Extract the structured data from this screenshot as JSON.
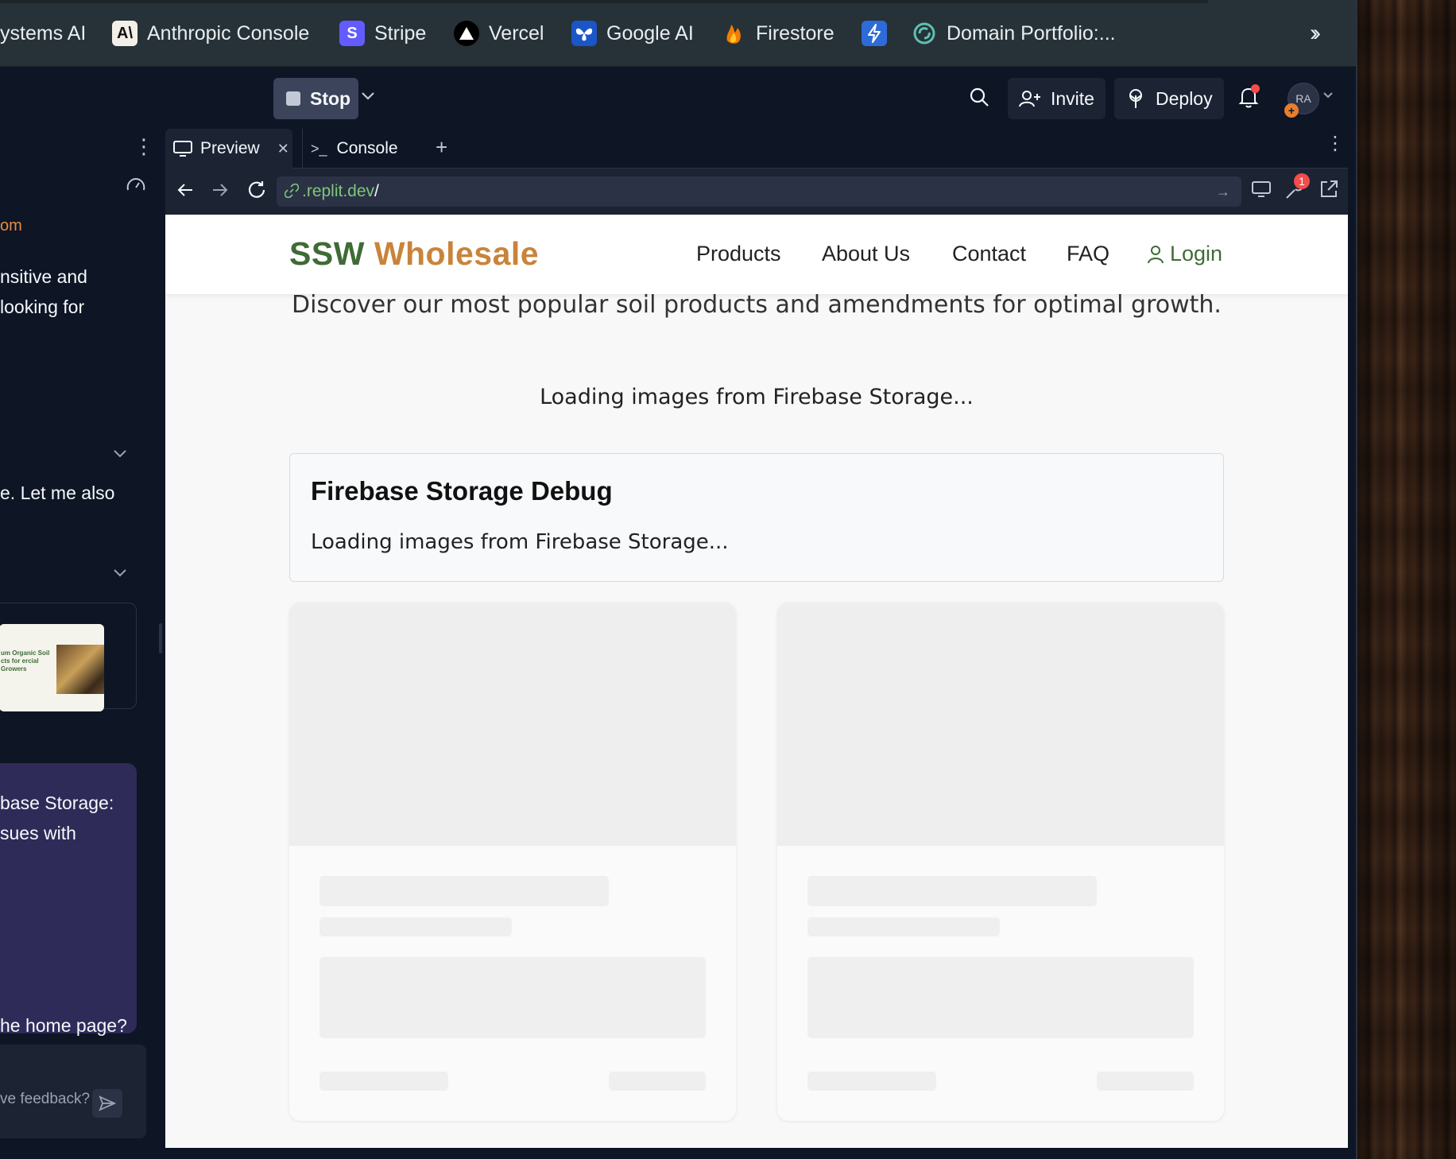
{
  "bookmarks": [
    {
      "label": "ystems AI",
      "icon": "none"
    },
    {
      "label": "Anthropic Console",
      "icon": "anthropic-icon"
    },
    {
      "label": "Stripe",
      "icon": "stripe-icon"
    },
    {
      "label": "Vercel",
      "icon": "vercel-icon"
    },
    {
      "label": "Google AI",
      "icon": "google-ai-icon"
    },
    {
      "label": "Firestore",
      "icon": "firebase-icon"
    },
    {
      "label": "",
      "icon": "bolt-icon"
    },
    {
      "label": "Domain Portfolio:...",
      "icon": "domain-icon"
    }
  ],
  "header": {
    "stop_label": "Stop",
    "invite_label": "Invite",
    "deploy_label": "Deploy",
    "avatar_initials": "RA"
  },
  "chat": {
    "lines": [
      {
        "text": "om",
        "style": "orange"
      },
      {
        "text": "nsitive and"
      },
      {
        "text": " looking for"
      },
      {
        "text": "e. Let me also"
      },
      {
        "text": "base Storage:"
      },
      {
        "text": "sues with"
      },
      {
        "text": "he home page?"
      }
    ],
    "thumb_text": "um Organic Soil cts for ercial Growers",
    "feedback_placeholder": "ve feedback?"
  },
  "tabs": [
    {
      "label": "Preview",
      "active": true
    },
    {
      "label": "Console",
      "active": false
    }
  ],
  "url": {
    "host": ".replit.dev",
    "path": "/"
  },
  "devtools_badge": "1",
  "site": {
    "brand_part1": "SSW",
    "brand_part2": "Wholesale",
    "nav": [
      "Products",
      "About Us",
      "Contact",
      "FAQ"
    ],
    "login_label": "Login",
    "subtitle": "Discover our most popular soil products and amendments for optimal growth.",
    "loading_text": "Loading images from Firebase Storage...",
    "debug_title": "Firebase Storage Debug",
    "debug_text": "Loading images from Firebase Storage..."
  },
  "colors": {
    "brand_green": "#3f6b36",
    "brand_orange": "#c8843a",
    "url_green": "#7ec77a",
    "purple_bubble": "#2f2b58"
  }
}
